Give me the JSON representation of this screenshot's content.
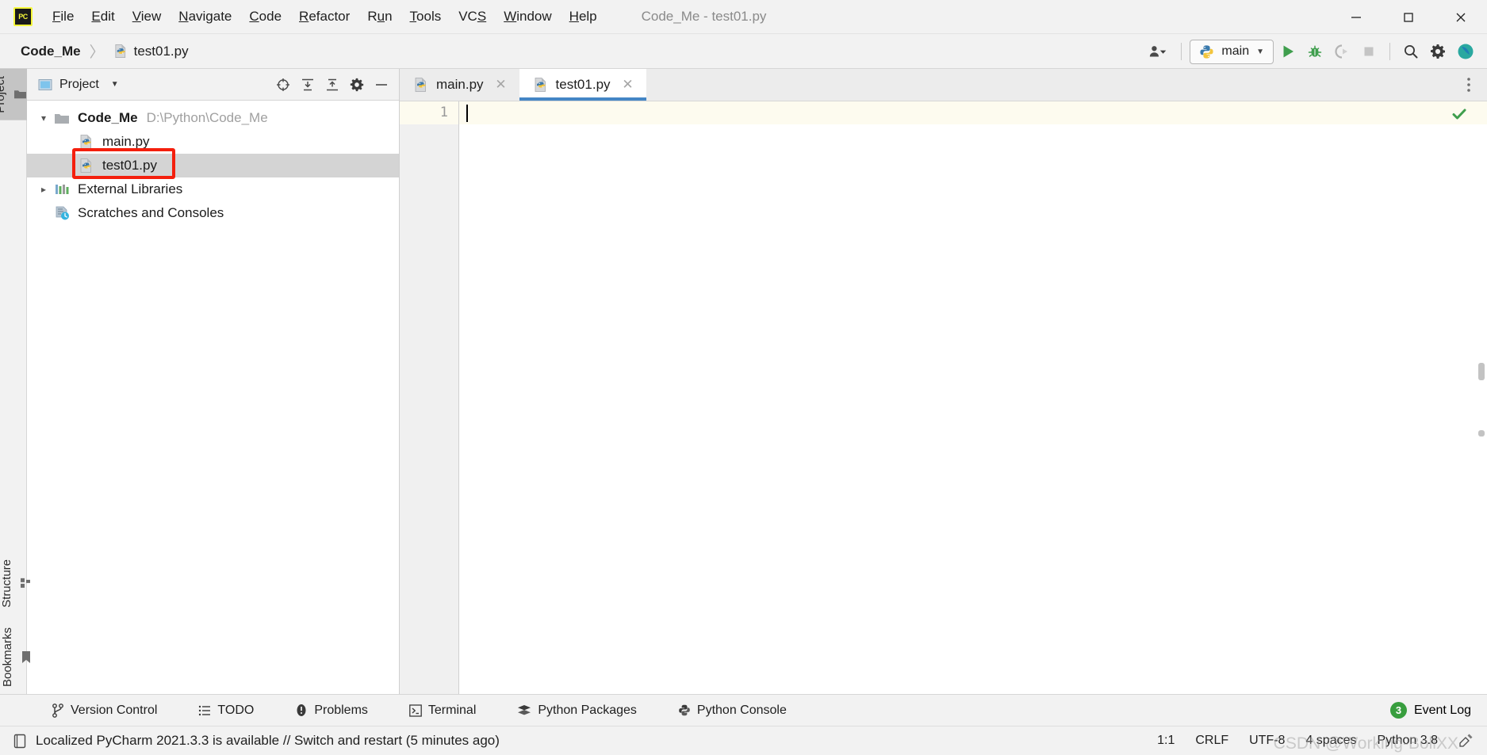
{
  "window": {
    "title": "Code_Me - test01.py",
    "app_icon": "pycharm-logo-icon",
    "controls": {
      "minimize": "—",
      "maximize": "□",
      "close": "✕"
    }
  },
  "menubar": {
    "items": [
      {
        "label": "File",
        "mnemonic": "F"
      },
      {
        "label": "Edit",
        "mnemonic": "E"
      },
      {
        "label": "View",
        "mnemonic": "V"
      },
      {
        "label": "Navigate",
        "mnemonic": "N"
      },
      {
        "label": "Code",
        "mnemonic": "C"
      },
      {
        "label": "Refactor",
        "mnemonic": "R"
      },
      {
        "label": "Run",
        "mnemonic": "u"
      },
      {
        "label": "Tools",
        "mnemonic": "T"
      },
      {
        "label": "VCS",
        "mnemonic": "S"
      },
      {
        "label": "Window",
        "mnemonic": "W"
      },
      {
        "label": "Help",
        "mnemonic": "H"
      }
    ]
  },
  "navbar": {
    "breadcrumbs": [
      {
        "label": "Code_Me",
        "icon": null
      },
      {
        "label": "test01.py",
        "icon": "python-file-icon"
      }
    ],
    "separator": "〉",
    "toolbar": {
      "account_icon": "user-account-icon",
      "run_config": {
        "label": "main",
        "icon": "python-icon",
        "chevron": "▼"
      },
      "run_icon": "run-icon",
      "debug_icon": "debug-bug-icon",
      "coverage_icon": "run-with-coverage-icon",
      "stop_icon": "stop-icon",
      "search_icon": "search-icon",
      "settings_icon": "gear-icon",
      "updates_icon": "ide-updates-icon"
    }
  },
  "left_strip": {
    "top": [
      {
        "label": "Project",
        "icon": "folder-icon",
        "active": true
      }
    ],
    "bottom": [
      {
        "label": "Structure",
        "icon": "structure-icon",
        "active": false
      },
      {
        "label": "Bookmarks",
        "icon": "bookmark-icon",
        "active": false
      }
    ]
  },
  "project_panel": {
    "title": "Project",
    "title_icon": "project-view-icon",
    "chevron": "▼",
    "actions": [
      {
        "name": "select-opened-file-icon",
        "tooltip": "Select Opened File"
      },
      {
        "name": "expand-all-icon",
        "tooltip": "Expand All"
      },
      {
        "name": "collapse-all-icon",
        "tooltip": "Collapse All"
      },
      {
        "name": "gear-icon",
        "tooltip": "Options"
      },
      {
        "name": "hide-icon",
        "tooltip": "Hide"
      }
    ],
    "tree": [
      {
        "label": "Code_Me",
        "path": "D:\\Python\\Code_Me",
        "icon": "folder-icon",
        "twisty": "expanded",
        "depth": 0,
        "bold": true,
        "selected": false
      },
      {
        "label": "main.py",
        "path": "",
        "icon": "python-file-icon",
        "twisty": "none",
        "depth": 1,
        "bold": false,
        "selected": false
      },
      {
        "label": "test01.py",
        "path": "",
        "icon": "python-file-icon",
        "twisty": "none",
        "depth": 1,
        "bold": false,
        "selected": true,
        "annotated": true
      },
      {
        "label": "External Libraries",
        "path": "",
        "icon": "libraries-icon",
        "twisty": "collapsed",
        "depth": 0,
        "bold": false,
        "selected": false
      },
      {
        "label": "Scratches and Consoles",
        "path": "",
        "icon": "scratches-icon",
        "twisty": "none",
        "depth": 0,
        "bold": false,
        "selected": false
      }
    ]
  },
  "editor": {
    "tabs": [
      {
        "label": "main.py",
        "icon": "python-file-icon",
        "active": false,
        "close": "✕"
      },
      {
        "label": "test01.py",
        "icon": "python-file-icon",
        "active": true,
        "close": "✕"
      }
    ],
    "more_icon": "more-options-icon",
    "line_numbers": [
      "1"
    ],
    "lines": [
      ""
    ],
    "inspection_status": "ok-checkmark-icon"
  },
  "bottom_bar": {
    "items": [
      {
        "label": "Version Control",
        "icon": "branch-icon"
      },
      {
        "label": "TODO",
        "icon": "todo-list-icon"
      },
      {
        "label": "Problems",
        "icon": "problems-icon"
      },
      {
        "label": "Terminal",
        "icon": "terminal-icon"
      },
      {
        "label": "Python Packages",
        "icon": "packages-icon"
      },
      {
        "label": "Python Console",
        "icon": "python-console-icon"
      }
    ],
    "event_log": {
      "label": "Event Log",
      "count": "3"
    }
  },
  "status_bar": {
    "message_icon": "notification-icon",
    "message": "Localized PyCharm 2021.3.3 is available // Switch and restart (5 minutes ago)",
    "caret_position": "1:1",
    "line_separator": "CRLF",
    "encoding": "UTF-8",
    "indent": "4 spaces",
    "interpreter": "Python 3.8",
    "watermark": "CSDN @Working-BoliXX"
  },
  "colors": {
    "accent_blue": "#4486c5",
    "annotation_red": "#f41f0d",
    "run_green": "#3f9e4d",
    "selection_gray": "#d4d4d4",
    "current_line": "#fdfbef",
    "badge_green": "#389e3e"
  }
}
